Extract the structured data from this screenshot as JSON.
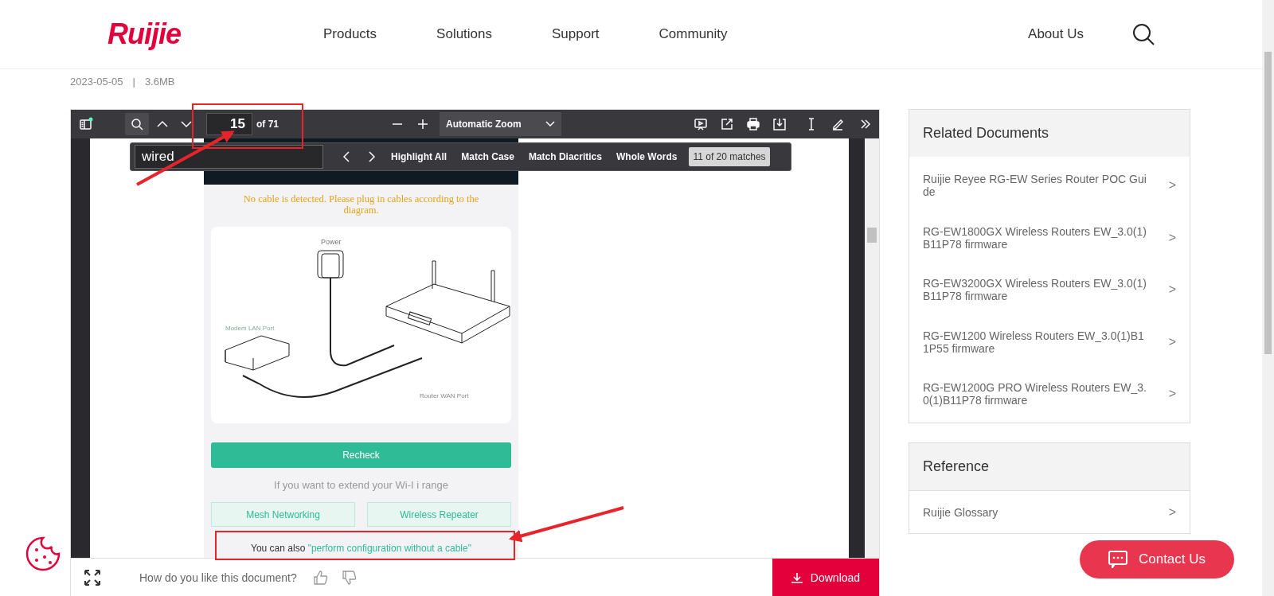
{
  "header": {
    "logo": "Ruijie",
    "nav": [
      "Products",
      "Solutions",
      "Support",
      "Community"
    ],
    "about": "About Us"
  },
  "meta": {
    "date": "2023-05-05",
    "separator": "|",
    "size": "3.6MB"
  },
  "viewer": {
    "toolbar": {
      "page": "15",
      "page_count": "of 71",
      "zoom": "Automatic Zoom"
    },
    "find": {
      "query": "wired",
      "options": [
        "Highlight All",
        "Match Case",
        "Match Diacritics",
        "Whole Words"
      ],
      "result": "11 of 20 matches"
    },
    "document": {
      "warning": "No cable is detected. Please plug in cables according to the diagram.",
      "labels": {
        "power": "Power",
        "modem": "Modem LAN Port",
        "router": "Router WAN Port"
      },
      "recheck": "Recheck",
      "extend": "If you want to extend your Wi-I i range",
      "modes": [
        "Mesh Networking",
        "Wireless Repeater"
      ],
      "note_prefix": "You can also",
      "note_link": "\"perform configuration without a cable\""
    },
    "feedback": {
      "question": "How do you like this document?"
    },
    "download": "Download"
  },
  "related": {
    "title": "Related Documents",
    "items": [
      {
        "label": "Ruijie Reyee RG-EW Series Router POC Guide",
        "arrow": ">"
      },
      {
        "label": "RG-EW1800GX Wireless Routers EW_3.0(1)B11P78 firmware",
        "arrow": ">"
      },
      {
        "label": "RG-EW3200GX Wireless Routers EW_3.0(1)B11P78 firmware",
        "arrow": ">"
      },
      {
        "label": "RG-EW1200 Wireless Routers EW_3.0(1)B11P55 firmware",
        "arrow": ">"
      },
      {
        "label": "RG-EW1200G PRO Wireless Routers EW_3.0(1)B11P78 firmware",
        "arrow": ">"
      }
    ]
  },
  "reference": {
    "title": "Reference",
    "items": [
      {
        "label": "Ruijie Glossary",
        "arrow": ">"
      }
    ]
  },
  "contact": "Contact Us"
}
